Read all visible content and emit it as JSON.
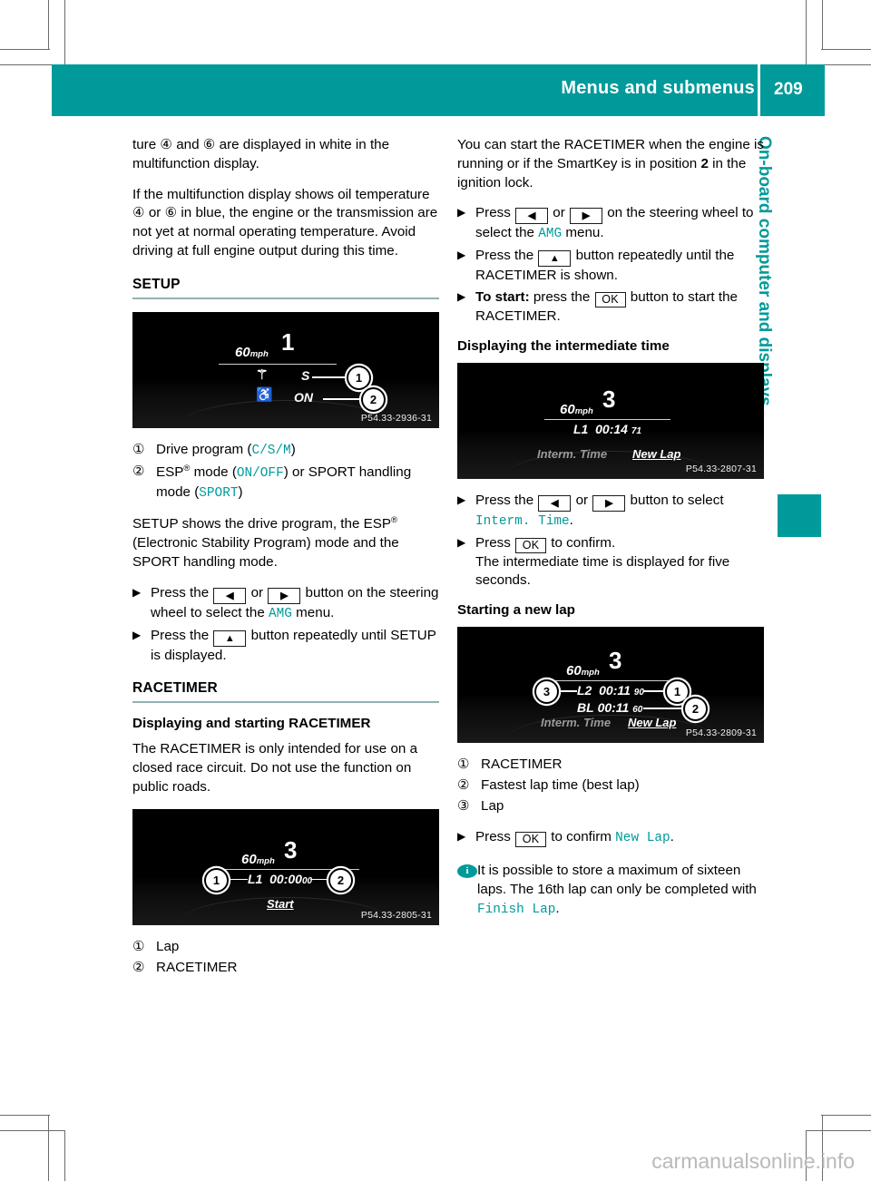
{
  "header": {
    "title": "Menus and submenus",
    "page_number": "209",
    "accent_color": "#009a9a"
  },
  "side_tab": {
    "label": "On-board computer and displays"
  },
  "watermark": "carmanualsonline.info",
  "left_column": {
    "intro_paragraph_1_a": "ture ",
    "intro_marker_4": "④",
    "intro_paragraph_1_b": " and ",
    "intro_marker_6": "⑥",
    "intro_paragraph_1_c": " are displayed in white in the multifunction display.",
    "intro_paragraph_2_a": "If the multifunction display shows oil temperature ",
    "intro_paragraph_2_b": " or ",
    "intro_paragraph_2_c": " in blue, the engine or the transmission are not yet at normal operating temperature. Avoid driving at full engine output during this time.",
    "setup_heading": "SETUP",
    "setup_image": {
      "code": "P54.33-2936-31",
      "gear": "1",
      "speed": "60",
      "speed_unit": "mph",
      "drive_program_value": "S",
      "esp_value": "ON",
      "callout_1": "1",
      "callout_2": "2"
    },
    "setup_legend": [
      {
        "marker": "①",
        "text_before": "Drive program (",
        "value": "C/S/M",
        "text_after": ")"
      },
      {
        "marker": "②",
        "text_before": "ESP",
        "sup": "®",
        "text_mid": " mode (",
        "value": "ON/OFF",
        "text_mid2": ") or SPORT handling mode (",
        "value2": "SPORT",
        "text_after": ")"
      }
    ],
    "setup_description_a": "SETUP shows the drive program, the ESP",
    "setup_description_sup": "®",
    "setup_description_b": " (Electronic Stability Program) mode and the SPORT handling mode.",
    "setup_steps": [
      {
        "text_a": "Press the ",
        "key1": "◀",
        "text_b": " or ",
        "key2": "▶",
        "text_c": " button on the steering wheel to select the ",
        "value": "AMG",
        "text_d": " menu."
      },
      {
        "text_a": "Press the ",
        "key1": "▲",
        "text_c": " button repeatedly until SETUP is displayed."
      }
    ],
    "racetimer_heading": "RACETIMER",
    "racetimer_subheading": "Displaying and starting RACETIMER",
    "racetimer_paragraph": "The RACETIMER is only intended for use on a closed race circuit. Do not use the function on public roads.",
    "racetimer_image": {
      "code": "P54.33-2805-31",
      "gear": "3",
      "speed": "60",
      "speed_unit": "mph",
      "lap_label": "L1",
      "time_main": "00:00",
      "time_decimal": "00",
      "menu_item": "Start",
      "callout_1": "1",
      "callout_2": "2"
    },
    "racetimer_legend": [
      {
        "marker": "①",
        "text": "Lap"
      },
      {
        "marker": "②",
        "text": "RACETIMER"
      }
    ]
  },
  "right_column": {
    "intro_paragraph_a": "You can start the RACETIMER when the engine is running or if the SmartKey is in position ",
    "intro_bold": "2",
    "intro_paragraph_b": " in the ignition lock.",
    "start_steps": [
      {
        "text_a": "Press ",
        "key1": "◀",
        "text_b": " or ",
        "key2": "▶",
        "text_c": " on the steering wheel to select the ",
        "value": "AMG",
        "text_d": " menu."
      },
      {
        "text_a": "Press the ",
        "key1": "▲",
        "text_c": " button repeatedly until the RACETIMER is shown."
      },
      {
        "bold_lead": "To start:",
        "text_a": " press the ",
        "key_ok": "OK",
        "text_c": " button to start the RACETIMER."
      }
    ],
    "intermediate_heading": "Displaying the intermediate time",
    "intermediate_image": {
      "code": "P54.33-2807-31",
      "gear": "3",
      "speed": "60",
      "speed_unit": "mph",
      "lap_label": "L1",
      "time_main": "00:14",
      "time_decimal": "71",
      "menu_item_dim": "Interm. Time",
      "menu_item": "New Lap"
    },
    "intermediate_steps": [
      {
        "text_a": "Press the ",
        "key1": "◀",
        "text_b": " or ",
        "key2": "▶",
        "text_c": " button to select ",
        "value": "Interm. Time",
        "text_d": "."
      },
      {
        "text_a": "Press ",
        "key_ok": "OK",
        "text_c": " to confirm.",
        "followup": "The intermediate time is displayed for five seconds."
      }
    ],
    "newlap_heading": "Starting a new lap",
    "newlap_image": {
      "code": "P54.33-2809-31",
      "gear": "3",
      "speed": "60",
      "speed_unit": "mph",
      "lap_label": "L2",
      "lap_time_main": "00:11",
      "lap_time_decimal": "90",
      "best_label": "BL",
      "best_time_main": "00:11",
      "best_time_decimal": "60",
      "menu_item_dim": "Interm. Time",
      "menu_item": "New Lap",
      "callout_1": "1",
      "callout_2": "2",
      "callout_3": "3"
    },
    "newlap_legend": [
      {
        "marker": "①",
        "text": "RACETIMER"
      },
      {
        "marker": "②",
        "text": "Fastest lap time (best lap)"
      },
      {
        "marker": "③",
        "text": "Lap"
      }
    ],
    "newlap_step": {
      "text_a": "Press ",
      "key_ok": "OK",
      "text_c": " to confirm ",
      "value": "New Lap",
      "text_d": "."
    },
    "note": {
      "icon": "i",
      "text_a": "It is possible to store a maximum of sixteen laps. The 16th lap can only be completed with ",
      "value": "Finish Lap",
      "text_b": "."
    }
  }
}
